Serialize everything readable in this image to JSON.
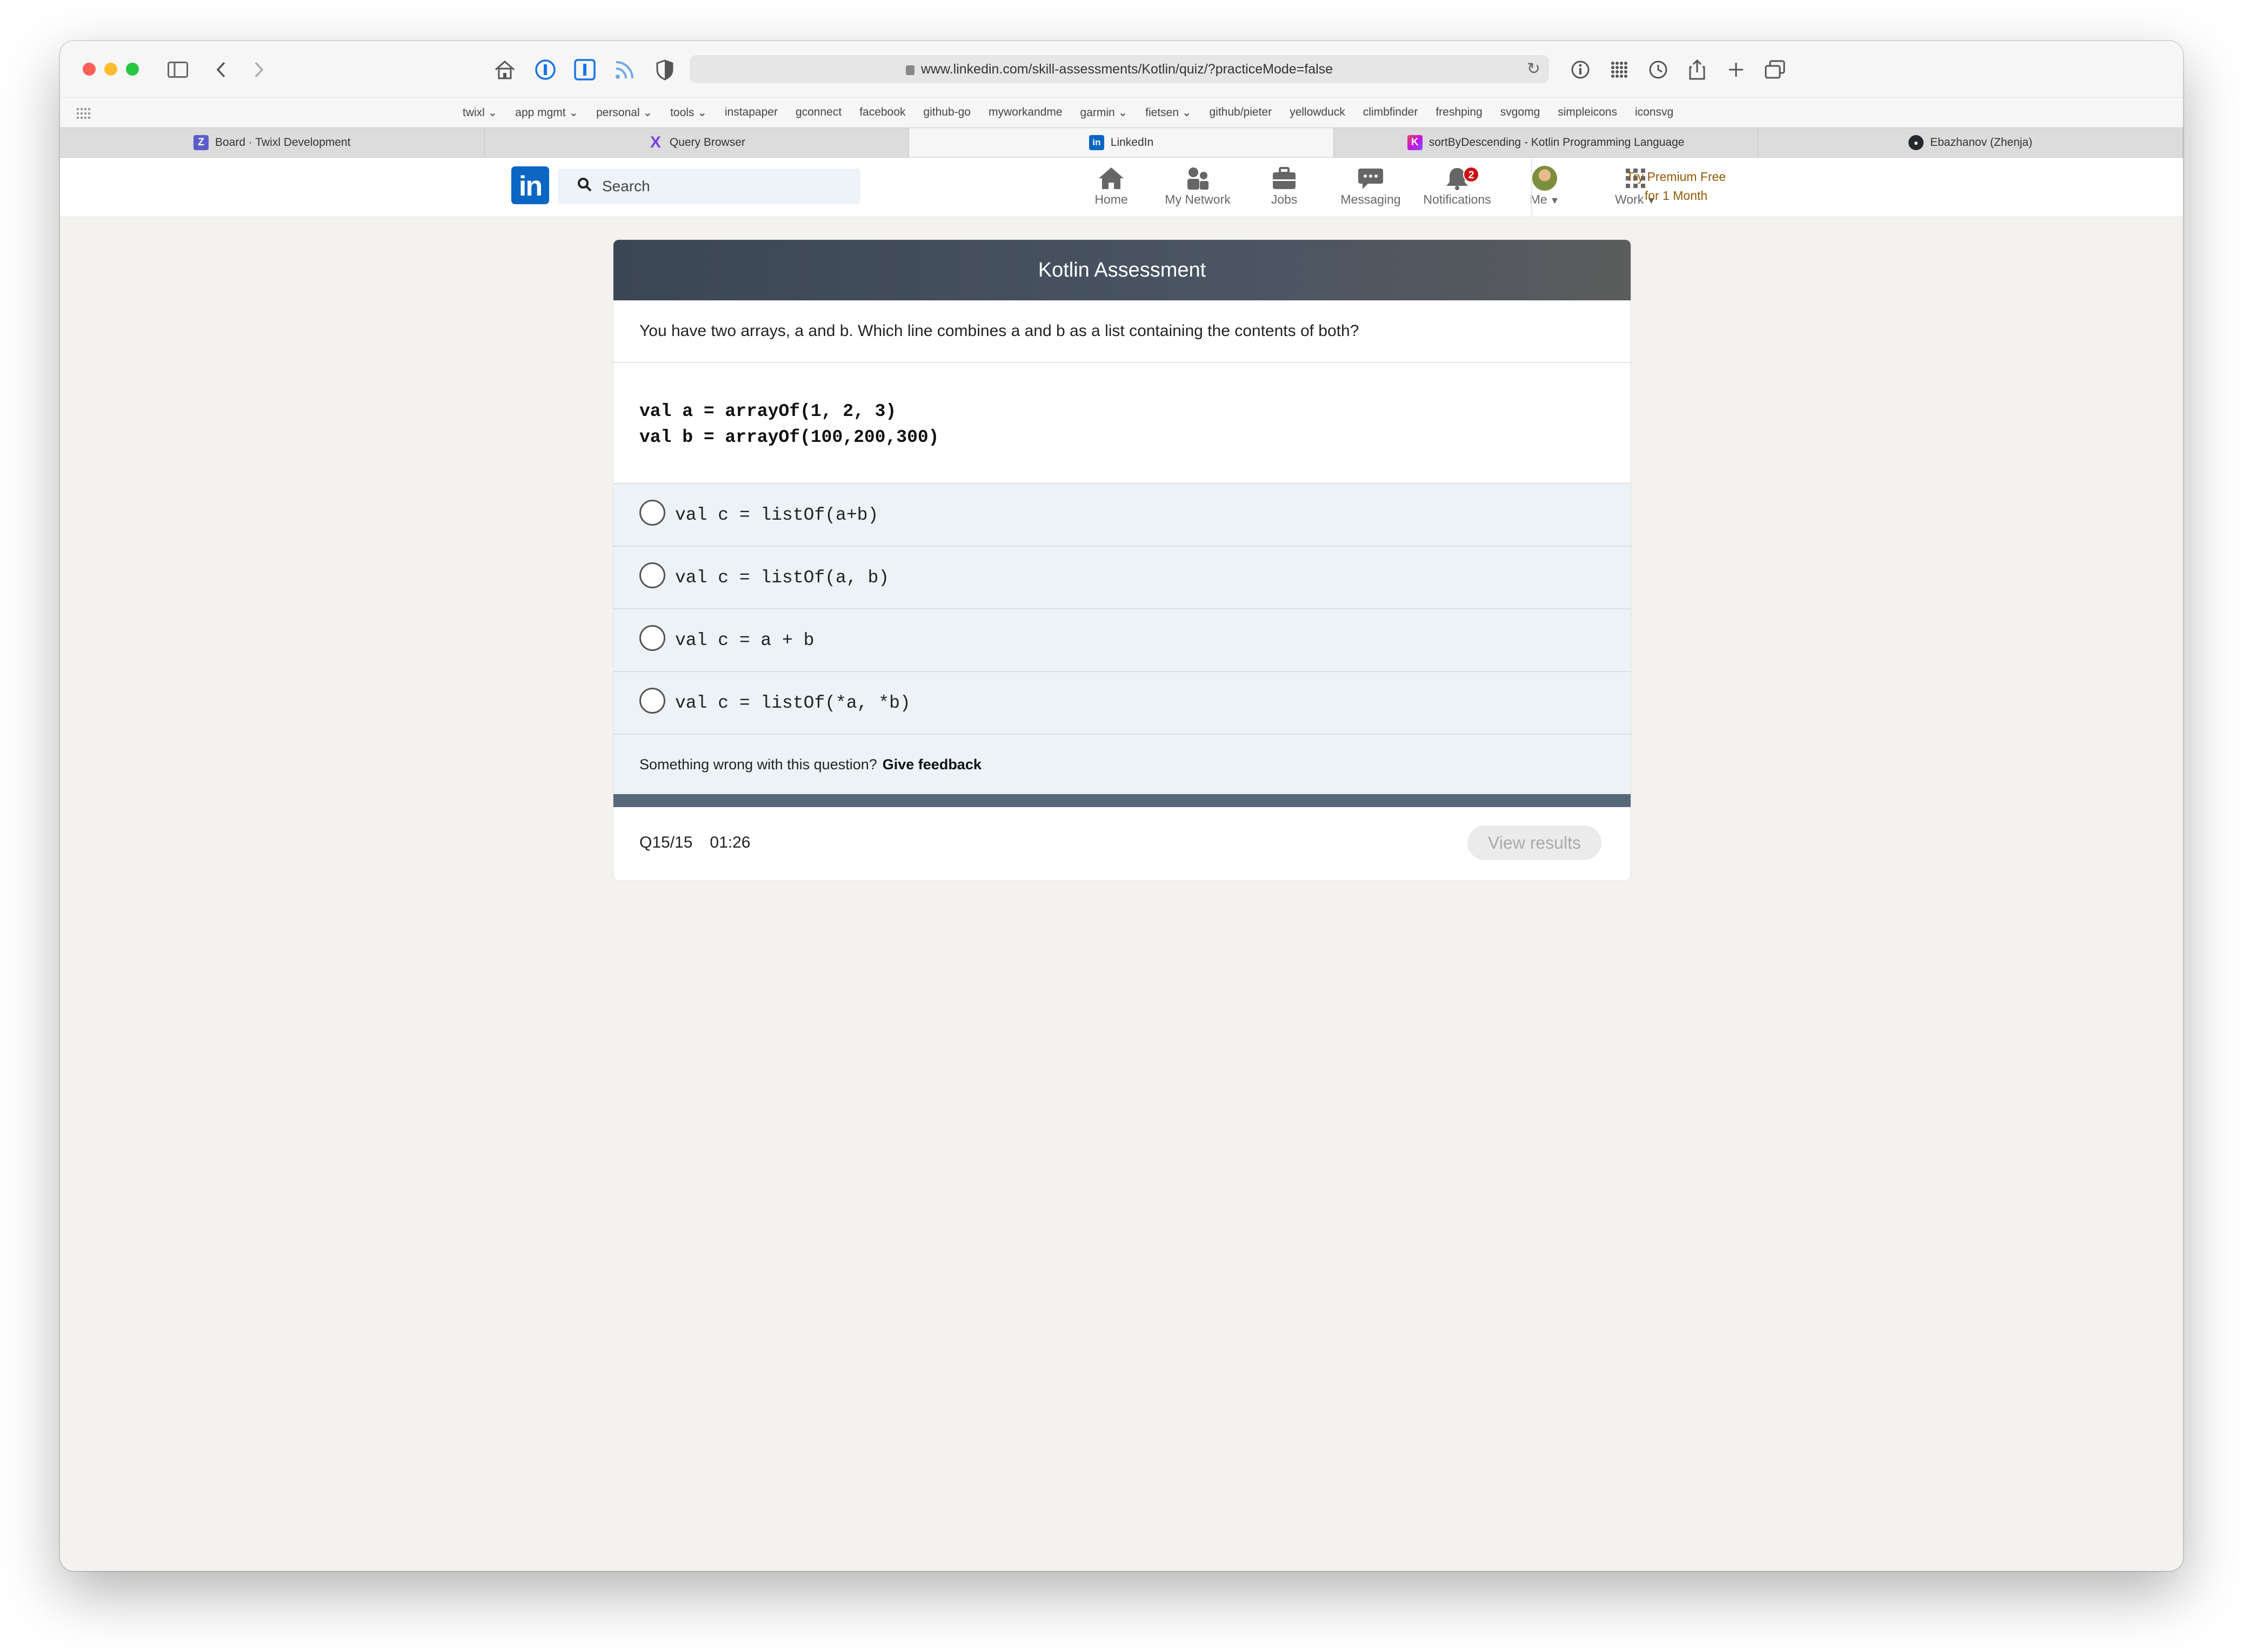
{
  "browser": {
    "url": "www.linkedin.com/skill-assessments/Kotlin/quiz/?practiceMode=false",
    "bookmarks": [
      "twixl ⌄",
      "app mgmt ⌄",
      "personal ⌄",
      "tools ⌄",
      "instapaper",
      "gconnect",
      "facebook",
      "github-go",
      "myworkandme",
      "garmin ⌄",
      "fietsen ⌄",
      "github/pieter",
      "yellowduck",
      "climbfinder",
      "freshping",
      "svgomg",
      "simpleicons",
      "iconsvg"
    ],
    "tabs": [
      {
        "label": "Board · Twixl Development",
        "favicon": "Z",
        "favicon_color": "#5c5ccc"
      },
      {
        "label": "Query Browser",
        "favicon": "X",
        "favicon_color": "#7b3fe4"
      },
      {
        "label": "LinkedIn",
        "favicon": "in",
        "favicon_color": "#0a66c2"
      },
      {
        "label": "sortByDescending - Kotlin Programming Language",
        "favicon": "K",
        "favicon_color": "#c757bc"
      },
      {
        "label": "Ebazhanov (Zhenja)",
        "favicon": "●",
        "favicon_color": "#24292e"
      }
    ]
  },
  "linkedin": {
    "logo": "in",
    "search_placeholder": "Search",
    "nav": {
      "home": "Home",
      "network": "My Network",
      "jobs": "Jobs",
      "messaging": "Messaging",
      "notifications": "Notifications",
      "me": "Me",
      "work": "Work"
    },
    "notification_count": "2",
    "premium": {
      "line1": "Try Premium Free",
      "line2": "for 1 Month"
    },
    "colors": {
      "brand": "#0a66c2",
      "premium": "#915907"
    }
  },
  "assessment": {
    "title": "Kotlin Assessment",
    "question": "You have two arrays, a and b. Which line combines a and b as a list containing the contents of both?",
    "code": [
      "val a = arrayOf(1, 2, 3)",
      "val b = arrayOf(100,200,300)"
    ],
    "options": [
      "val c = listOf(a+b)",
      "val c = listOf(a, b)",
      "val c = a + b",
      "val c = listOf(*a, *b)"
    ],
    "feedback_text": "Something wrong with this question?",
    "feedback_link": "Give feedback",
    "progress": "Q15/15",
    "timer": "01:26",
    "view_results": "View results"
  }
}
